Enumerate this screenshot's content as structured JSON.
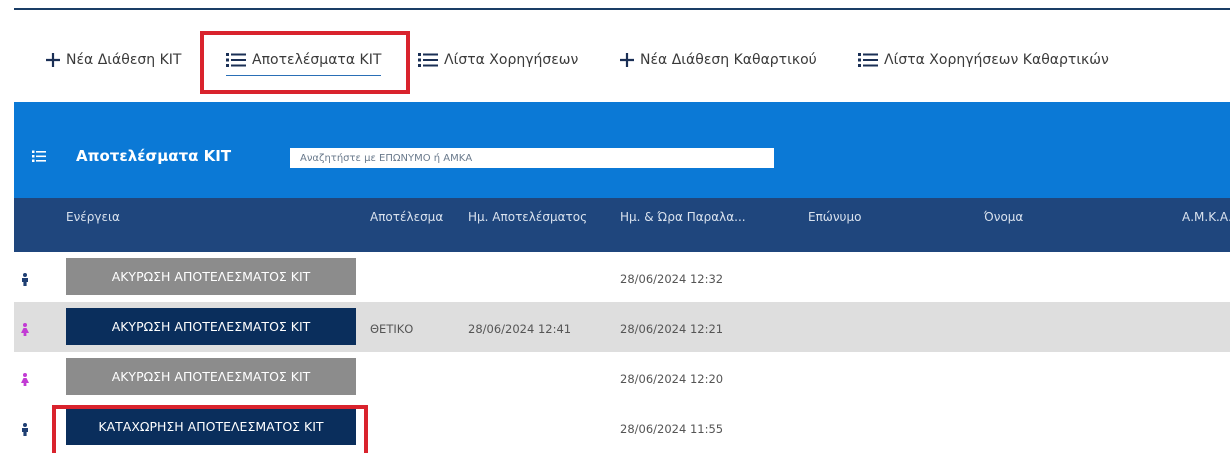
{
  "nav": {
    "items": [
      {
        "icon": "plus-icon",
        "label": "Νέα Διάθεση ΚΙΤ"
      },
      {
        "icon": "list-icon",
        "label": "Αποτελέσματα ΚΙΤ"
      },
      {
        "icon": "list-icon",
        "label": "Λίστα Χορηγήσεων"
      },
      {
        "icon": "plus-icon",
        "label": "Νέα Διάθεση Καθαρτικού"
      },
      {
        "icon": "list-icon",
        "label": "Λίστα Χορηγήσεων Καθαρτικών"
      }
    ],
    "active": "Αποτελέσματα ΚΙΤ"
  },
  "panel": {
    "title": "Αποτελέσματα ΚΙΤ",
    "search_placeholder": "Αναζητήστε με ΕΠΩΝΥΜΟ ή ΑΜΚΑ"
  },
  "table": {
    "columns": [
      "Ενέργεια",
      "Αποτέλεσμα",
      "Ημ. Αποτελέσματος",
      "Ημ. & Ώρα Παραλα...",
      "Επώνυμο",
      "Όνομα",
      "Α.Μ.Κ.Α."
    ],
    "rows": [
      {
        "gender": "male",
        "action": "ΑΚΥΡΩΣΗ ΑΠΟΤΕΛΕΣΜΑΤΟΣ ΚΙΤ",
        "action_style": "gray",
        "result": "",
        "result_date": "",
        "received": "28/06/2024 12:32",
        "surname": "",
        "name": "",
        "amka": ""
      },
      {
        "gender": "female",
        "action": "ΑΚΥΡΩΣΗ ΑΠΟΤΕΛΕΣΜΑΤΟΣ ΚΙΤ",
        "action_style": "navy",
        "result": "ΘΕΤΙΚΟ",
        "result_date": "28/06/2024 12:41",
        "received": "28/06/2024 12:21",
        "surname": "",
        "name": "",
        "amka": ""
      },
      {
        "gender": "female",
        "action": "ΑΚΥΡΩΣΗ ΑΠΟΤΕΛΕΣΜΑΤΟΣ ΚΙΤ",
        "action_style": "gray",
        "result": "",
        "result_date": "",
        "received": "28/06/2024 12:20",
        "surname": "",
        "name": "",
        "amka": ""
      },
      {
        "gender": "male",
        "action": "ΚΑΤΑΧΩΡΗΣΗ ΑΠΟΤΕΛΕΣΜΑΤΟΣ ΚΙΤ",
        "action_style": "navy",
        "result": "",
        "result_date": "",
        "received": "28/06/2024 11:55",
        "surname": "",
        "name": "",
        "amka": ""
      }
    ]
  },
  "colors": {
    "header_blue": "#0b79d6",
    "column_header_navy": "#1f467d",
    "button_navy": "#0a2e5c",
    "button_gray": "#8c8c8c",
    "highlight_red": "#d9232d",
    "male_icon": "#1f3f73",
    "female_icon": "#c23bd4"
  }
}
